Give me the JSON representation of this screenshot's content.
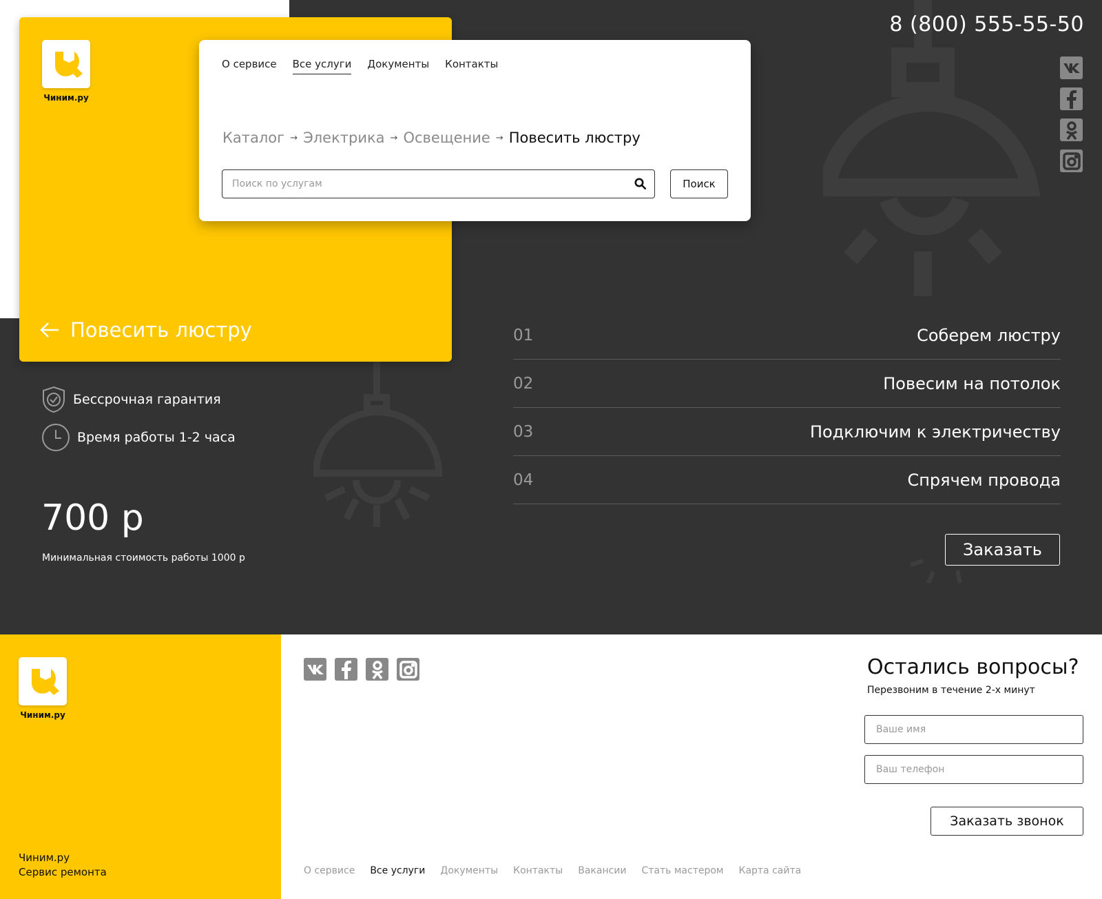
{
  "brand": {
    "logo_text": "Чиним.ру"
  },
  "header": {
    "phone": "8 (800) 555-55-50",
    "nav": [
      {
        "label": "О сервисе"
      },
      {
        "label": "Все услуги",
        "active": true
      },
      {
        "label": "Документы"
      },
      {
        "label": "Контакты"
      }
    ],
    "breadcrumbs": [
      "Каталог",
      "Электрика",
      "Освещение",
      "Повесить люстру"
    ],
    "search": {
      "placeholder": "Поиск по услугам",
      "button_label": "Поиск"
    }
  },
  "social_icons": [
    "vk-icon",
    "facebook-icon",
    "odnoklassniki-icon",
    "instagram-icon"
  ],
  "service": {
    "title": "Повесить люстру",
    "features": [
      {
        "icon": "shield-check-icon",
        "text": "Бессрочная гарантия"
      },
      {
        "icon": "clock-icon",
        "text": "Время работы 1-2 часа"
      }
    ],
    "price": "700 р",
    "price_note": "Минимальная стоимость работы 1000 р",
    "steps": [
      {
        "num": "01",
        "label": "Соберем люстру"
      },
      {
        "num": "02",
        "label": "Повесим на потолок"
      },
      {
        "num": "03",
        "label": "Подключим к электричеству"
      },
      {
        "num": "04",
        "label": "Спрячем провода"
      }
    ],
    "order_label": "Заказать"
  },
  "footer": {
    "company_line1": "Чиним.ру",
    "company_line2": "Сервис ремонта",
    "questions_title": "Остались вопросы?",
    "questions_sub": "Перезвоним в течение 2-х минут",
    "name_placeholder": "Ваше имя",
    "phone_placeholder": "Ваш телефон",
    "callback_label": "Заказать звонок",
    "nav": [
      {
        "label": "О сервисе"
      },
      {
        "label": "Все услуги",
        "active": true
      },
      {
        "label": "Документы"
      },
      {
        "label": "Контакты"
      },
      {
        "label": "Вакансии"
      },
      {
        "label": "Стать мастером"
      },
      {
        "label": "Карта сайта"
      }
    ]
  },
  "colors": {
    "accent": "#ffc700",
    "dark": "#333333",
    "muted": "#9a9a9a"
  }
}
